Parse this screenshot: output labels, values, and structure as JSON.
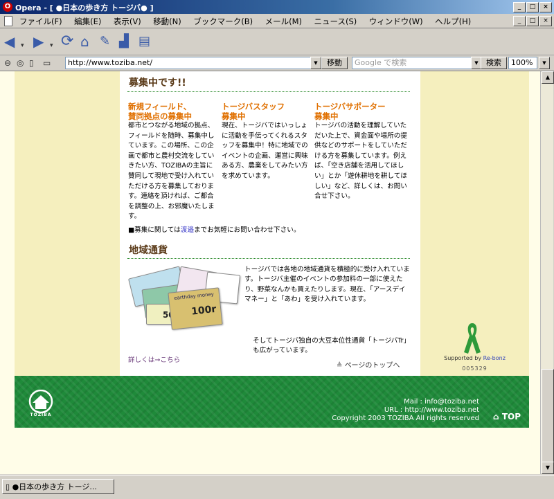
{
  "window": {
    "title": "Opera - [ ●日本の歩き方 トージバ● ]",
    "min_label": "_",
    "max_label": "□",
    "close_label": "×",
    "mdi_close_label": "×"
  },
  "menu": {
    "items": [
      "ファイル(F)",
      "編集(E)",
      "表示(V)",
      "移動(N)",
      "ブックマーク(B)",
      "メール(M)",
      "ニュース(S)",
      "ウィンドウ(W)",
      "ヘルプ(H)"
    ]
  },
  "toolbar": {
    "icons": [
      "back-icon",
      "forward-icon",
      "reload-icon",
      "home-icon",
      "hotlist-icon",
      "print-icon",
      "document-icon"
    ]
  },
  "address": {
    "url": "http://www.toziba.net/",
    "go_label": "移動",
    "search_placeholder": "Google で検索",
    "search_label": "検索",
    "zoom": "100%"
  },
  "page": {
    "recruit": {
      "heading": "募集中です!!",
      "columns": [
        {
          "title_line1": "新規フィールド、",
          "title_line2": "賛同拠点の募集中",
          "body": "都市とつながる地域の拠点、フィールドを随時、募集中しています。この場所、この企画で都市と農村交流をしていきたい方、TOZIBAの主旨に賛同して現地で受け入れていただける方を募集しております。連絡を頂ければ、ご都合を調整の上、お邪魔いたします。"
        },
        {
          "title_line1": "トージバスタッフ",
          "title_line2": "募集中",
          "body": "現在、トージバではいっしょに活動を手伝ってくれるスタッフを募集中！特に地域でのイベントの企画、運営に興味ある方、農業をしてみたい方を求めています。"
        },
        {
          "title_line1": "トージバサポーター",
          "title_line2": "募集中",
          "body": "トージバの活動を理解していただいた上で、資金面や場所の提供などのサポートをしていただける方を募集しています。例えば、「空き店舗を活用してほしい」とか「遊休耕地を耕してほしい」など、詳しくは、お問い合せ下さい。"
        }
      ],
      "note_prefix": "■募集に関しては",
      "note_link": "渡邉",
      "note_suffix": "までお気軽にお問い合わせ下さい。"
    },
    "currency": {
      "heading": "地域通貨",
      "text": "トージバでは各地の地域通貨を積極的に受け入れています。トージバ主催のイベントの参加料の一部に使えたり、野菜なんかも買えたりします。現在、「アースデイマネー」と「あわ」を受け入れています。",
      "text2": "そしてトージバ独自の大豆本位性通貨「トージバTr」も広がっています。",
      "link": "詳しくは→こちら",
      "bill_text_1": "earthday money",
      "bill_value_1": "500",
      "bill_value_2": "100r"
    },
    "page_top": "ページのトップへ",
    "supported_prefix": "Supported by ",
    "supported_link": "Re-bonz",
    "counter": "005329"
  },
  "footer": {
    "logo_text": "TOZIBA",
    "mail": "Mail : info@toziba.net",
    "url": "URL : http://www.toziba.net",
    "copyright": "Copyright 2003 TOZIBA All rights reserved",
    "top_label": "TOP"
  },
  "status": {
    "tab_label": "●日本の歩き方 トージ..."
  },
  "colors": {
    "accent_orange": "#e07000",
    "footer_green": "#1f8a3a",
    "side_cream": "#f5efbe"
  }
}
